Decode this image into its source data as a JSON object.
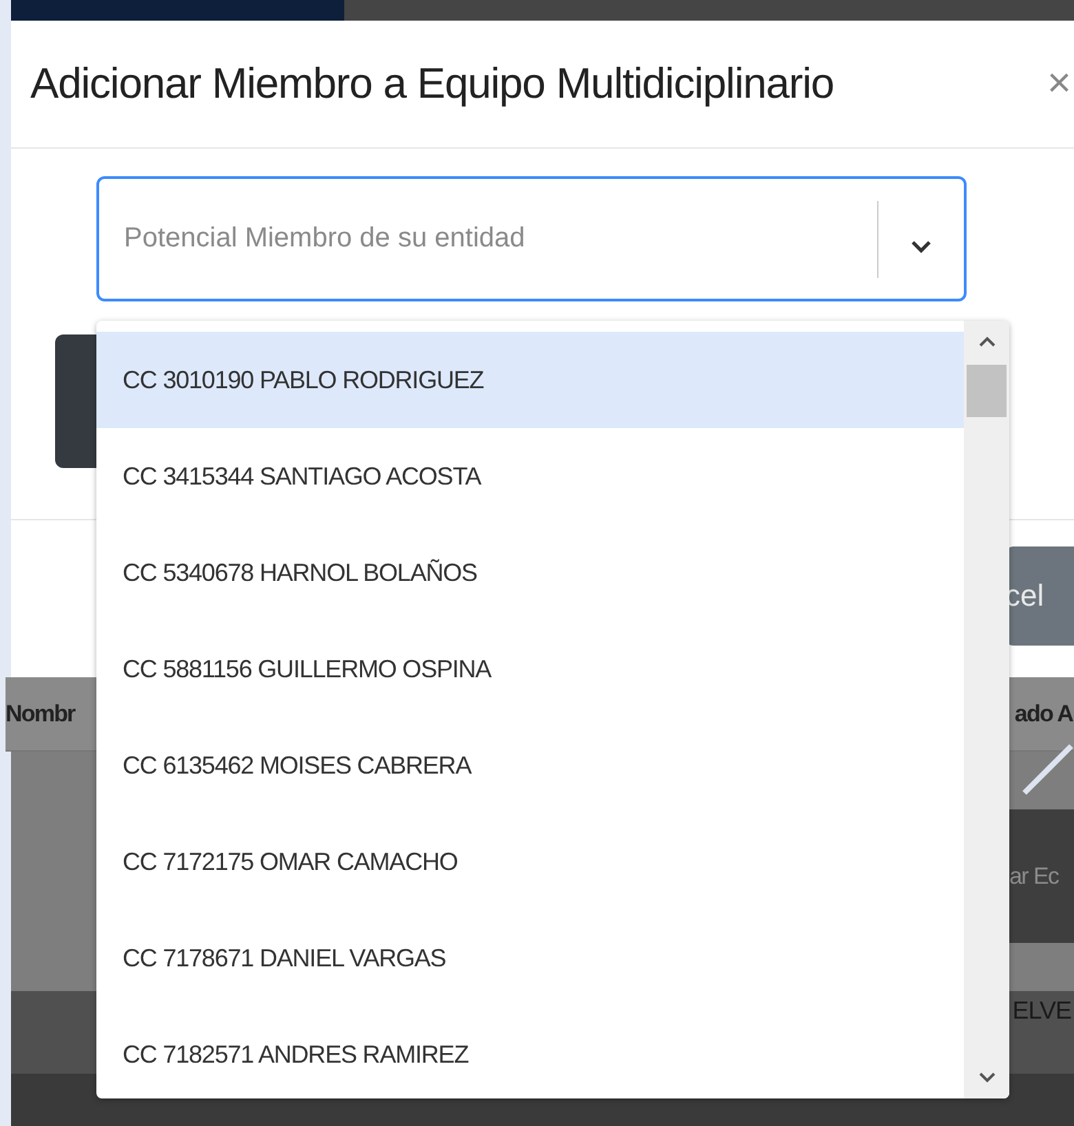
{
  "window": {
    "title": "Adicionar Miembro a Equipo Multidiciplinario",
    "close": "×"
  },
  "select": {
    "placeholder": "Potencial Miembro de su entidad",
    "expanded": true
  },
  "options": [
    {
      "label": "CC 3010190 PABLO RODRIGUEZ",
      "selected": true
    },
    {
      "label": "CC 3415344 SANTIAGO ACOSTA",
      "selected": false
    },
    {
      "label": "CC 5340678 HARNOL BOLAÑOS",
      "selected": false
    },
    {
      "label": "CC 5881156 GUILLERMO OSPINA",
      "selected": false
    },
    {
      "label": "CC 6135462 MOISES CABRERA",
      "selected": false
    },
    {
      "label": "CC 7172175 OMAR CAMACHO",
      "selected": false
    },
    {
      "label": "CC 7178671 DANIEL VARGAS",
      "selected": false
    },
    {
      "label": "CC 7182571 ANDRES RAMIREZ",
      "selected": false
    }
  ],
  "footer_button": "cel",
  "background": {
    "table_headers": [
      "Nombr",
      "ado A"
    ],
    "button": "ar Ec",
    "cell": "ELVE"
  }
}
